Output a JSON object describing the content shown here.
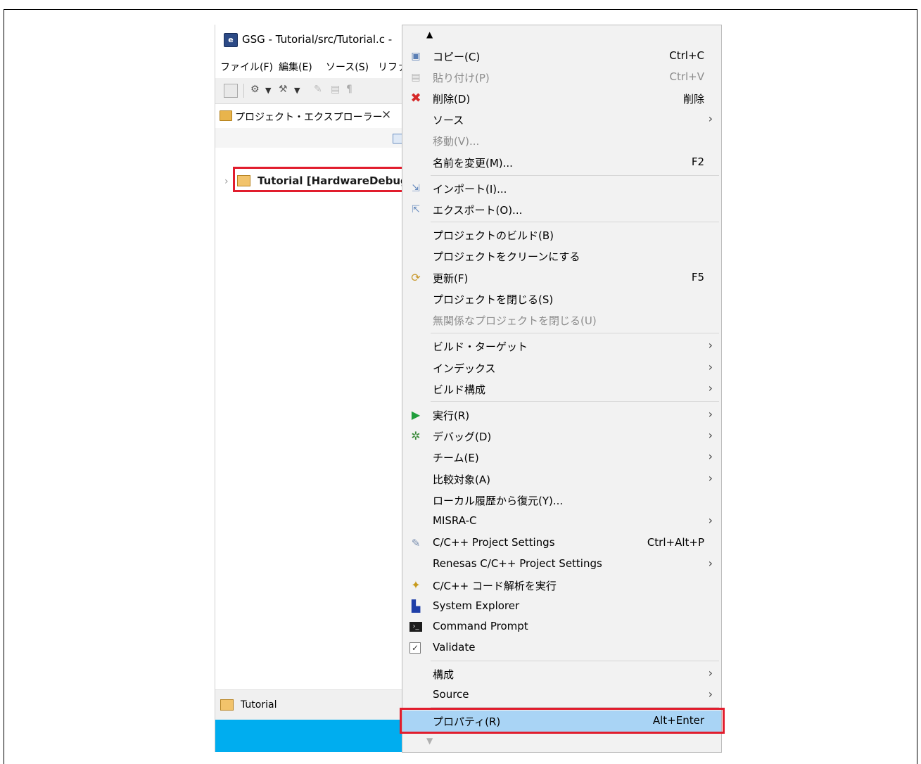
{
  "window": {
    "title": "GSG - Tutorial/src/Tutorial.c -",
    "menus": [
      "ファイル(F)",
      "編集(E)",
      "ソース(S)",
      "リファ"
    ],
    "view_tab_label": "プロジェクト・エクスプローラー",
    "view_tab_close": "×",
    "tree_item_label": "Tutorial [HardwareDebug",
    "status_item_label": "Tutorial"
  },
  "context_menu": {
    "items": [
      {
        "label": "コピー(C)",
        "accel": "Ctrl+C",
        "icon": "copy-icon"
      },
      {
        "label": "貼り付け(P)",
        "accel": "Ctrl+V",
        "icon": "paste-icon",
        "disabled": true
      },
      {
        "label": "削除(D)",
        "accel": "削除",
        "icon": "delete-icon"
      },
      {
        "label": "ソース",
        "submenu": true
      },
      {
        "label": "移動(V)...",
        "disabled": true
      },
      {
        "label": "名前を変更(M)...",
        "accel": "F2"
      },
      {
        "label": "インポート(I)...",
        "icon": "import-icon"
      },
      {
        "label": "エクスポート(O)...",
        "icon": "export-icon"
      },
      {
        "label": "プロジェクトのビルド(B)"
      },
      {
        "label": "プロジェクトをクリーンにする"
      },
      {
        "label": "更新(F)",
        "accel": "F5",
        "icon": "refresh-icon"
      },
      {
        "label": "プロジェクトを閉じる(S)"
      },
      {
        "label": "無関係なプロジェクトを閉じる(U)",
        "disabled": true
      },
      {
        "label": "ビルド・ターゲット",
        "submenu": true
      },
      {
        "label": "インデックス",
        "submenu": true
      },
      {
        "label": "ビルド構成",
        "submenu": true
      },
      {
        "label": "実行(R)",
        "submenu": true,
        "icon": "run-icon"
      },
      {
        "label": "デバッグ(D)",
        "submenu": true,
        "icon": "debug-icon"
      },
      {
        "label": "チーム(E)",
        "submenu": true
      },
      {
        "label": "比較対象(A)",
        "submenu": true
      },
      {
        "label": "ローカル履歴から復元(Y)..."
      },
      {
        "label": "MISRA-C",
        "submenu": true
      },
      {
        "label": "C/C++ Project Settings",
        "accel": "Ctrl+Alt+P",
        "icon": "settings-icon"
      },
      {
        "label": "Renesas C/C++ Project Settings",
        "submenu": true
      },
      {
        "label": "C/C++ コード解析を実行",
        "icon": "code-analysis-icon"
      },
      {
        "label": "System Explorer",
        "icon": "system-explorer-icon"
      },
      {
        "label": "Command Prompt",
        "icon": "command-prompt-icon"
      },
      {
        "label": "Validate",
        "icon": "validate-checkbox-icon"
      },
      {
        "label": "構成",
        "submenu": true
      },
      {
        "label": "Source",
        "submenu": true
      },
      {
        "label": "プロパティ(R)",
        "accel": "Alt+Enter",
        "active": true
      }
    ]
  },
  "colors": {
    "highlight_box": "#e11d2d",
    "menu_selected": "#a9d4f5",
    "taskbar": "#00adef"
  }
}
